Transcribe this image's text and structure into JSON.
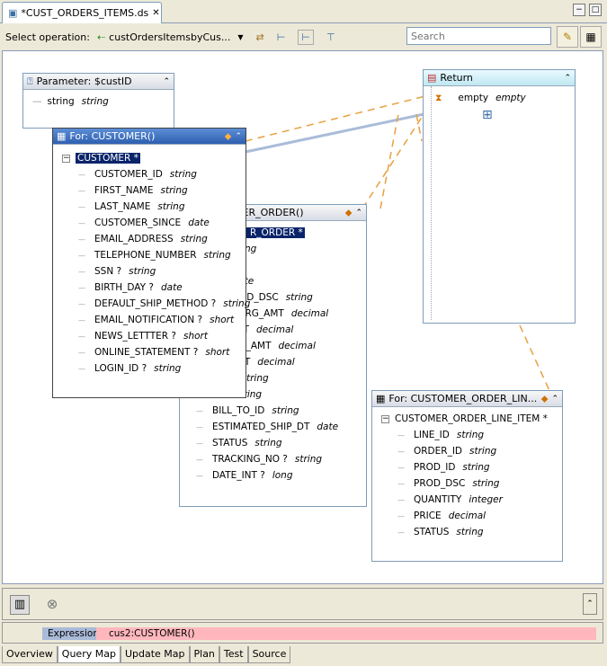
{
  "window": {
    "tab_title": "*CUST_ORDERS_ITEMS.ds",
    "close": "✕",
    "minimize": "−",
    "maximize": "□"
  },
  "toolbar": {
    "select_operation_label": "Select operation:",
    "operation_value": "custOrdersItemsbyCus...",
    "search_placeholder": "Search"
  },
  "parameter": {
    "title": "Parameter: $custID",
    "rows": [
      {
        "name": "string",
        "type": "string"
      }
    ]
  },
  "return_box": {
    "title": "Return",
    "rows": [
      {
        "name": "empty",
        "type": "empty"
      }
    ]
  },
  "customer": {
    "title": "For: CUSTOMER()",
    "root": "CUSTOMER *",
    "rows": [
      {
        "name": "CUSTOMER_ID",
        "type": "string"
      },
      {
        "name": "FIRST_NAME",
        "type": "string"
      },
      {
        "name": "LAST_NAME",
        "type": "string"
      },
      {
        "name": "CUSTOMER_SINCE",
        "type": "date"
      },
      {
        "name": "EMAIL_ADDRESS",
        "type": "string"
      },
      {
        "name": "TELEPHONE_NUMBER",
        "type": "string"
      },
      {
        "name": "SSN ?",
        "type": "string"
      },
      {
        "name": "BIRTH_DAY ?",
        "type": "date"
      },
      {
        "name": "DEFAULT_SHIP_METHOD ?",
        "type": "string"
      },
      {
        "name": "EMAIL_NOTIFICATION ?",
        "type": "short"
      },
      {
        "name": "NEWS_LETTTER ?",
        "type": "short"
      },
      {
        "name": "ONLINE_STATEMENT ?",
        "type": "short"
      },
      {
        "name": "LOGIN_ID ?",
        "type": "string"
      }
    ]
  },
  "order": {
    "title": "MER_ORDER()",
    "root": "R_ORDER *",
    "rows": [
      {
        "name": "ID",
        "type": "string"
      },
      {
        "name": "",
        "type": "string"
      },
      {
        "name": "DT",
        "type": "date"
      },
      {
        "name": "METHOD_DSC",
        "type": "string"
      },
      {
        "name": "NG_CHRG_AMT",
        "type": "decimal"
      },
      {
        "name": "AL_AMT",
        "type": "decimal"
      },
      {
        "name": "ORDER_AMT",
        "type": "decimal"
      },
      {
        "name": "AX_AMT",
        "type": "decimal"
      },
      {
        "name": "D_ID",
        "type": "string"
      },
      {
        "name": "NM",
        "type": "string"
      },
      {
        "name": "BILL_TO_ID",
        "type": "string"
      },
      {
        "name": "ESTIMATED_SHIP_DT",
        "type": "date"
      },
      {
        "name": "STATUS",
        "type": "string"
      },
      {
        "name": "TRACKING_NO ?",
        "type": "string"
      },
      {
        "name": "DATE_INT ?",
        "type": "long"
      }
    ]
  },
  "line_item": {
    "title": "For: CUSTOMER_ORDER_LIN...",
    "root": "CUSTOMER_ORDER_LINE_ITEM *",
    "rows": [
      {
        "name": "LINE_ID",
        "type": "string"
      },
      {
        "name": "ORDER_ID",
        "type": "string"
      },
      {
        "name": "PROD_ID",
        "type": "string"
      },
      {
        "name": "PROD_DSC",
        "type": "string"
      },
      {
        "name": "QUANTITY",
        "type": "integer"
      },
      {
        "name": "PRICE",
        "type": "decimal"
      },
      {
        "name": "STATUS",
        "type": "string"
      }
    ]
  },
  "expression": {
    "label": "Expression",
    "value": "cus2:CUSTOMER()"
  },
  "bottom_tabs": [
    "Overview",
    "Query Map",
    "Update Map",
    "Plan",
    "Test",
    "Source"
  ],
  "colors": {
    "selected_header": "#2d5fb0",
    "mapping_line": "#e8a040",
    "link_line": "#a9bcd9",
    "expression_value_bg": "#ffb7bd"
  }
}
